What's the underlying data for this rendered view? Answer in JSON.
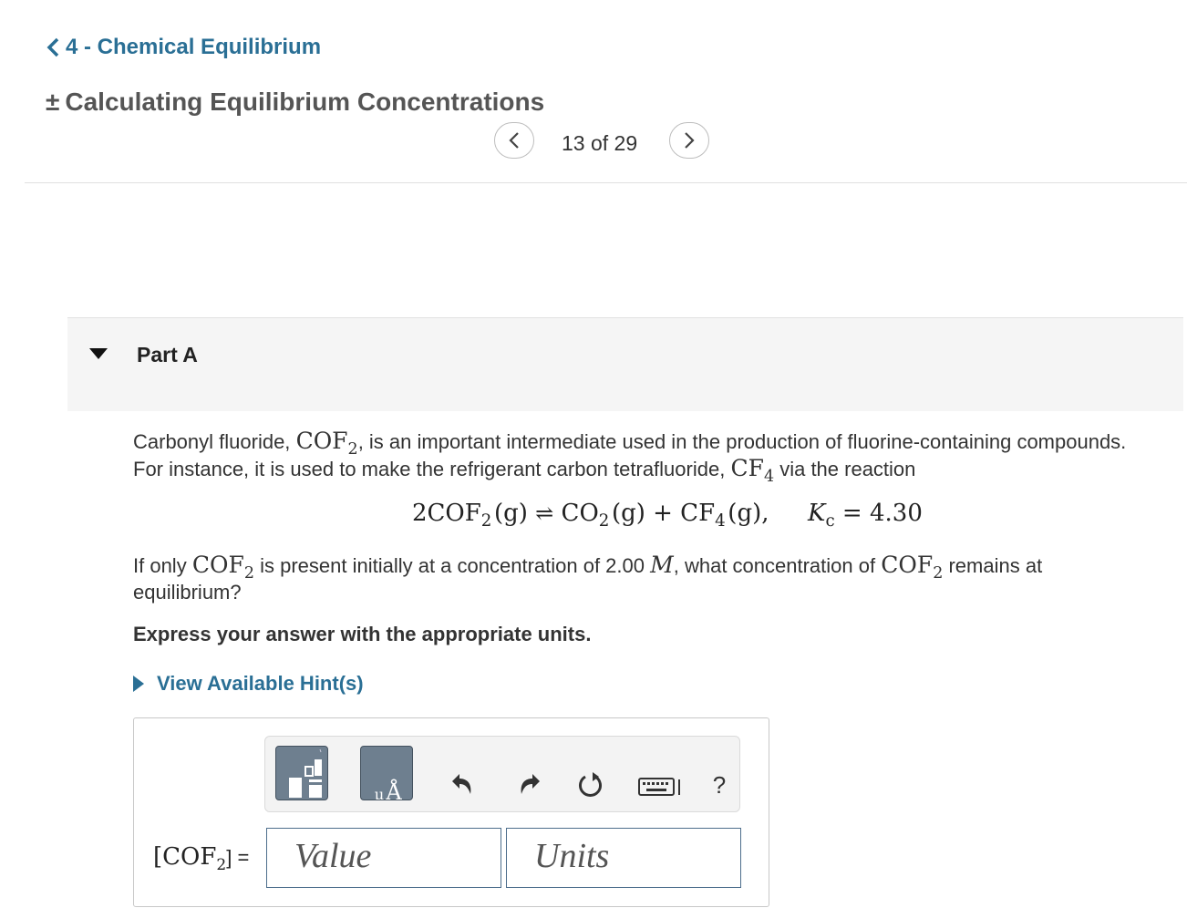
{
  "header": {
    "chapter_link": "4 - Chemical Equilibrium",
    "section_title": "Calculating Equilibrium Concentrations",
    "section_prefix": "±"
  },
  "pager": {
    "text": "13 of 29",
    "prev": "<",
    "next": ">"
  },
  "part": {
    "label": "Part A"
  },
  "question": {
    "p1_a": "Carbonyl fluoride,",
    "p1_cof": "COF",
    "p1_cof_sub": "2",
    "p1_b": ", is an important intermediate used in the production of fluorine-containing compounds. For instance, it is used to make the refrigerant carbon tetrafluoride,",
    "p1_cf": "CF",
    "p1_cf_sub": "4",
    "p1_c": "via the reaction",
    "eq": {
      "lhs_coef": "2COF",
      "lhs_sub": "2",
      "lhs_state": "(g)",
      "arrow": "⇌",
      "p1": "CO",
      "p1_sub": "2",
      "p1_state": "(g) + CF",
      "p2_sub": "4",
      "p2_state": "(g),",
      "k": "K",
      "k_sub": "c",
      "k_val": "= 4.30"
    },
    "p2_a": "If only",
    "p2_cof": "COF",
    "p2_cof_sub": "2",
    "p2_b": "is present initially at a concentration of 2.00",
    "p2_m": "M",
    "p2_c": ", what concentration of",
    "p2_cof2": "COF",
    "p2_cof2_sub": "2",
    "p2_d": "remains at equilibrium?",
    "instruction": "Express your answer with the appropriate units."
  },
  "hints": {
    "label": "View Available Hint(s)"
  },
  "answer": {
    "label_open": "[COF",
    "label_sub": "2",
    "label_close": "] =",
    "value_placeholder": "Value",
    "units_placeholder": "Units",
    "toolbar": {
      "help": "?",
      "units_tile_glyph": "Å"
    }
  }
}
